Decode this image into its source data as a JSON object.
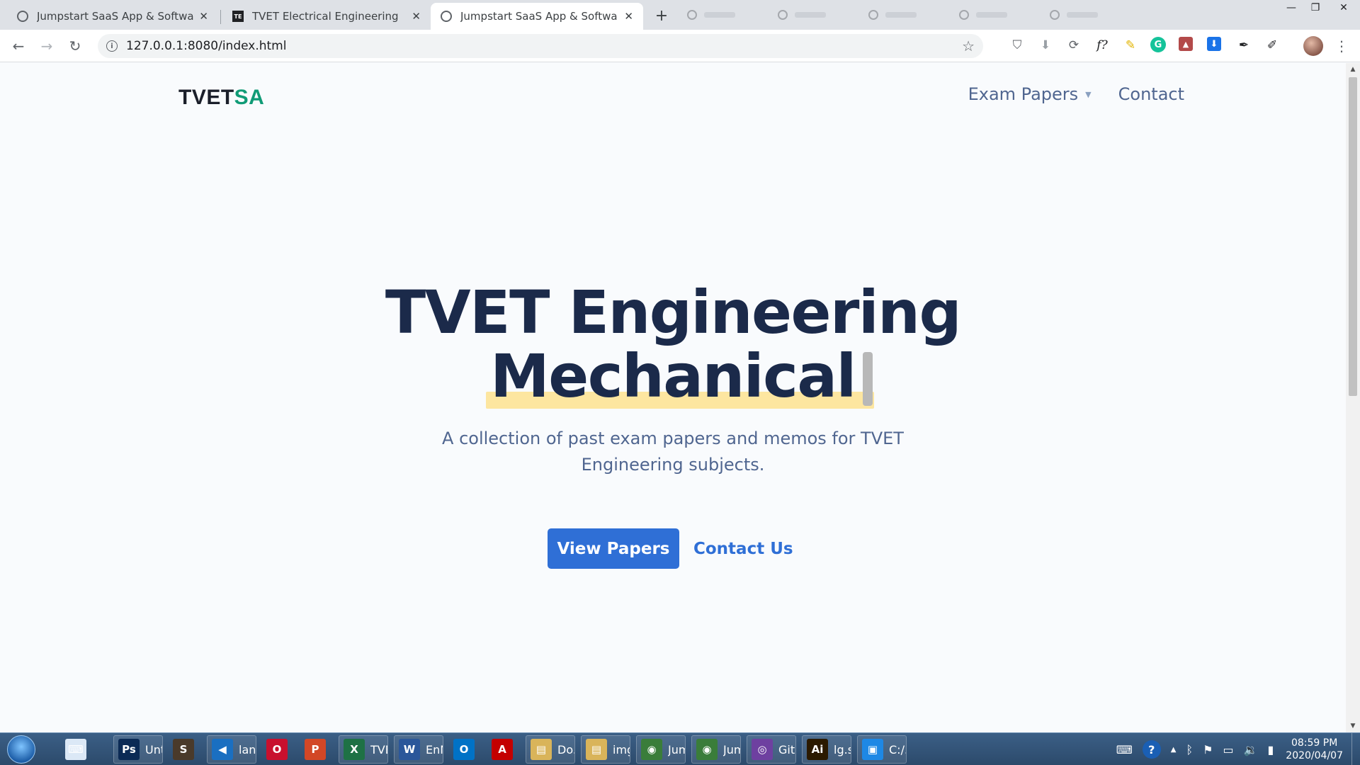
{
  "browser": {
    "tabs": [
      {
        "title": "Jumpstart SaaS App & Software Tem",
        "favicon": "globe-icon",
        "active": false
      },
      {
        "title": "TVET Electrical Engineering",
        "favicon": "te-logo",
        "favicon_text": "TE",
        "active": false
      },
      {
        "title": "Jumpstart SaaS App & Software Tem",
        "favicon": "globe-icon",
        "active": true
      }
    ],
    "new_tab_label": "+",
    "close_glyph": "✕",
    "window_controls": {
      "minimize": "—",
      "restore": "❐",
      "close": "✕"
    },
    "address": "127.0.0.1:8080/index.html",
    "nav": {
      "back": "←",
      "forward": "→",
      "reload": "↻"
    },
    "extensions": {
      "pocket": "⛉",
      "download": "⬇",
      "sync": "⟳",
      "formula": "f?",
      "highlighter": "✎",
      "grammarly": "G",
      "pdf": "▲",
      "download2": "⬇",
      "pen": "✒",
      "wand": "✐"
    },
    "menu_glyph": "⋮",
    "star_glyph": "☆"
  },
  "site": {
    "brand_prefix": "TVET",
    "brand_suffix": "SA",
    "brand_accent_color": "#109b76",
    "nav_exam_papers": "Exam Papers",
    "nav_caret": "▼",
    "nav_contact": "Contact",
    "hero_line1": "TVET Engineering",
    "hero_line2": "Mechanical",
    "highlight_color": "#fde6a0",
    "lead": "A collection of past exam papers and memos for TVET Engineering subjects.",
    "cta_primary": "View Papers",
    "cta_secondary": "Contact Us",
    "primary_color": "#2f6fd6"
  },
  "taskbar": {
    "items": [
      {
        "label": "",
        "icon": "keyboard-icon",
        "glyph": "⌨",
        "color": "#dbe8f6"
      },
      {
        "label": "Unti...",
        "icon": "photoshop-icon",
        "glyph": "Ps",
        "color": "#0b2a55"
      },
      {
        "label": "",
        "icon": "sublime-icon",
        "glyph": "S",
        "color": "#4a3a2a"
      },
      {
        "label": "lan...",
        "icon": "vscode-icon",
        "glyph": "◀",
        "color": "#1a6fc1"
      },
      {
        "label": "",
        "icon": "opera-icon",
        "glyph": "O",
        "color": "#c8102e"
      },
      {
        "label": "",
        "icon": "powerpoint-icon",
        "glyph": "P",
        "color": "#d24726"
      },
      {
        "label": "TVE...",
        "icon": "excel-icon",
        "glyph": "X",
        "color": "#1e7145"
      },
      {
        "label": "EnN...",
        "icon": "word-icon",
        "glyph": "W",
        "color": "#2b579a"
      },
      {
        "label": "",
        "icon": "outlook-icon",
        "glyph": "O",
        "color": "#0072c6"
      },
      {
        "label": "",
        "icon": "acrobat-icon",
        "glyph": "A",
        "color": "#c40000"
      },
      {
        "label": "Do...",
        "icon": "folder-icon",
        "glyph": "▤",
        "color": "#d9b45a"
      },
      {
        "label": "img",
        "icon": "folder-icon",
        "glyph": "▤",
        "color": "#d9b45a"
      },
      {
        "label": "Jum...",
        "icon": "chrome-icon",
        "glyph": "◉",
        "color": "#3a7d3a"
      },
      {
        "label": "Jum...",
        "icon": "chrome-icon",
        "glyph": "◉",
        "color": "#3a7d3a"
      },
      {
        "label": "Git...",
        "icon": "github-icon",
        "glyph": "◎",
        "color": "#6e40a0"
      },
      {
        "label": "lg.s...",
        "icon": "illustrator-icon",
        "glyph": "Ai",
        "color": "#2b1a00"
      },
      {
        "label": "C:/...",
        "icon": "terminal-icon",
        "glyph": "▣",
        "color": "#1e88e5"
      }
    ],
    "tray": {
      "keyboard": "⌨",
      "help": "?",
      "up": "▲",
      "bluetooth": "ᛒ",
      "flag": "⚑",
      "network": "▭",
      "volume": "🔉",
      "signal": "▮"
    },
    "time": "08:59 PM",
    "date": "2020/04/07"
  }
}
